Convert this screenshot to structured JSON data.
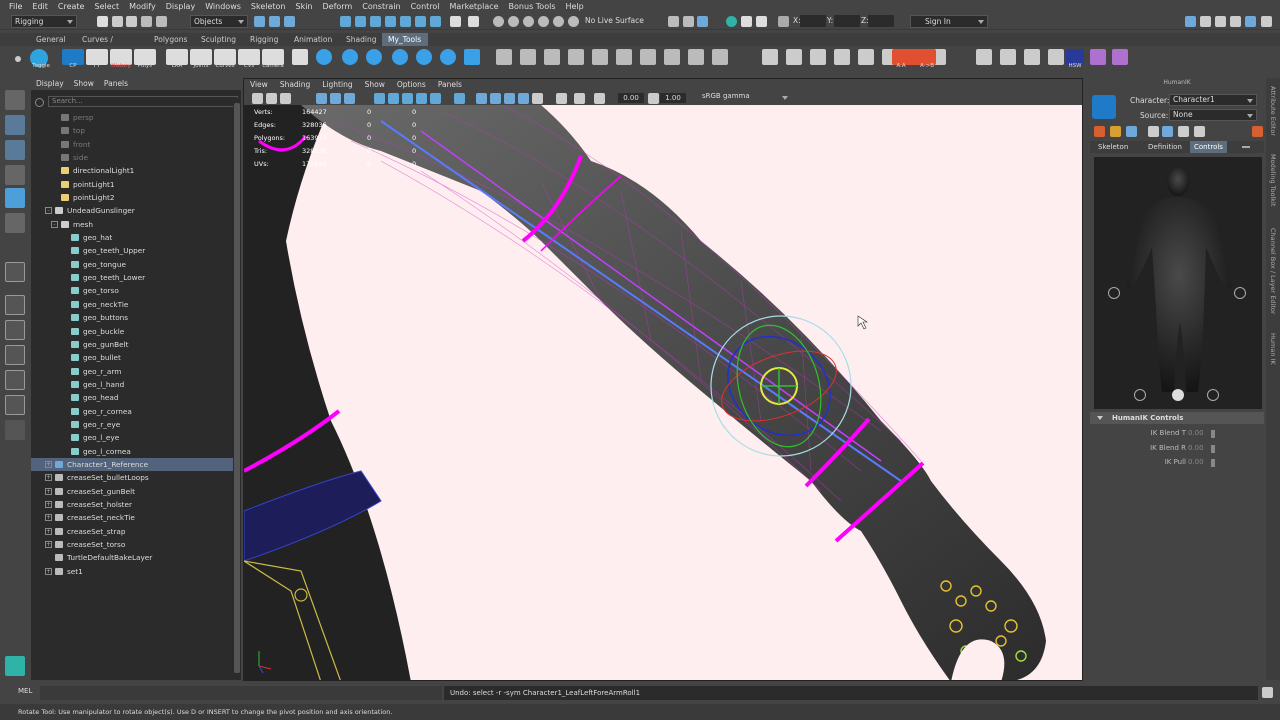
{
  "menu": [
    "File",
    "Edit",
    "Create",
    "Select",
    "Modify",
    "Display",
    "Windows",
    "Skeleton",
    "Skin",
    "Deform",
    "Constrain",
    "Control",
    "Marketplace",
    "Bonus Tools",
    "Help"
  ],
  "status": {
    "mode": "Rigging",
    "select_mode": "Objects",
    "live_surface": "No Live Surface",
    "x_label": "X:",
    "y_label": "Y:",
    "z_label": "Z:",
    "sign_in": "Sign In"
  },
  "shelf_tabs": [
    "General",
    "Curves / Surfaces",
    "Polygons",
    "Sculpting",
    "Rigging",
    "Animation",
    "Shading",
    "My_Tools"
  ],
  "shelf_active": "My_Tools",
  "shelf_labels": [
    "Toggle",
    "CP",
    "FT",
    "History",
    "Polys",
    "LRA",
    "Joints",
    "Curves",
    "CVs",
    "Camera"
  ],
  "shelf_right_labels": [
    "A:A",
    "A->B",
    "HSW"
  ],
  "outliner": {
    "menu": [
      "Display",
      "Show",
      "Panels"
    ],
    "search_placeholder": "Search...",
    "items": [
      {
        "label": "persp",
        "level": 1,
        "dim": true,
        "icon": "camera-icon"
      },
      {
        "label": "top",
        "level": 1,
        "dim": true,
        "icon": "camera-icon"
      },
      {
        "label": "front",
        "level": 1,
        "dim": true,
        "icon": "camera-icon"
      },
      {
        "label": "side",
        "level": 1,
        "dim": true,
        "icon": "camera-icon"
      },
      {
        "label": "directionalLight1",
        "level": 1,
        "icon": "light-icon"
      },
      {
        "label": "pointLight1",
        "level": 1,
        "icon": "light-icon"
      },
      {
        "label": "pointLight2",
        "level": 1,
        "icon": "light-icon"
      },
      {
        "label": "UndeadGunslinger",
        "level": 0,
        "expand": "-",
        "icon": "group-icon"
      },
      {
        "label": "mesh",
        "level": 1,
        "expand": "-",
        "icon": "group-icon"
      },
      {
        "label": "geo_hat",
        "level": 2,
        "icon": "mesh-icon"
      },
      {
        "label": "geo_teeth_Upper",
        "level": 2,
        "icon": "mesh-icon"
      },
      {
        "label": "geo_tongue",
        "level": 2,
        "icon": "mesh-icon"
      },
      {
        "label": "geo_teeth_Lower",
        "level": 2,
        "icon": "mesh-icon"
      },
      {
        "label": "geo_torso",
        "level": 2,
        "icon": "mesh-icon"
      },
      {
        "label": "geo_neckTie",
        "level": 2,
        "icon": "mesh-icon"
      },
      {
        "label": "geo_buttons",
        "level": 2,
        "icon": "mesh-icon"
      },
      {
        "label": "geo_buckle",
        "level": 2,
        "icon": "mesh-icon"
      },
      {
        "label": "geo_gunBelt",
        "level": 2,
        "icon": "mesh-icon"
      },
      {
        "label": "geo_bullet",
        "level": 2,
        "icon": "mesh-icon"
      },
      {
        "label": "geo_r_arm",
        "level": 2,
        "icon": "mesh-icon"
      },
      {
        "label": "geo_l_hand",
        "level": 2,
        "icon": "mesh-icon"
      },
      {
        "label": "geo_head",
        "level": 2,
        "icon": "mesh-icon"
      },
      {
        "label": "geo_r_cornea",
        "level": 2,
        "icon": "mesh-icon"
      },
      {
        "label": "geo_r_eye",
        "level": 2,
        "icon": "mesh-icon"
      },
      {
        "label": "geo_l_eye",
        "level": 2,
        "icon": "mesh-icon"
      },
      {
        "label": "geo_l_cornea",
        "level": 2,
        "icon": "mesh-icon"
      },
      {
        "label": "Character1_Reference",
        "level": 0,
        "expand": "+",
        "icon": "joint-icon",
        "selected": true
      },
      {
        "label": "creaseSet_bulletLoops",
        "level": 0,
        "expand": "+",
        "icon": "set-icon"
      },
      {
        "label": "creaseSet_gunBelt",
        "level": 0,
        "expand": "+",
        "icon": "set-icon"
      },
      {
        "label": "creaseSet_holster",
        "level": 0,
        "expand": "+",
        "icon": "set-icon"
      },
      {
        "label": "creaseSet_neckTie",
        "level": 0,
        "expand": "+",
        "icon": "set-icon"
      },
      {
        "label": "creaseSet_strap",
        "level": 0,
        "expand": "+",
        "icon": "set-icon"
      },
      {
        "label": "creaseSet_torso",
        "level": 0,
        "expand": "+",
        "icon": "set-icon"
      },
      {
        "label": "TurtleDefaultBakeLayer",
        "level": 0,
        "icon": "set-icon"
      },
      {
        "label": "set1",
        "level": 0,
        "expand": "+",
        "icon": "set-icon"
      }
    ]
  },
  "viewport": {
    "menu": [
      "View",
      "Shading",
      "Lighting",
      "Show",
      "Options",
      "Panels"
    ],
    "value_a": "0.00",
    "value_b": "1.00",
    "colorspace": "sRGB gamma",
    "hud": [
      {
        "k": "Verts:",
        "v1": "164427",
        "v2": "0",
        "v3": "0"
      },
      {
        "k": "Edges:",
        "v1": "328036",
        "v2": "0",
        "v3": "0"
      },
      {
        "k": "Polygons:",
        "v1": "163933",
        "v2": "0",
        "v3": "0"
      },
      {
        "k": "Tris:",
        "v1": "328236",
        "v2": "0",
        "v3": "0"
      },
      {
        "k": "UVs:",
        "v1": "175890",
        "v2": "0",
        "v3": "0"
      }
    ]
  },
  "humanik": {
    "title": "HumanIK",
    "character_label": "Character:",
    "character_value": "Character1",
    "source_label": "Source:",
    "source_value": "None",
    "tabs": [
      "Skeleton",
      "Definition",
      "Controls"
    ],
    "active_tab": "Controls",
    "controls_header": "HumanIK Controls",
    "params": [
      {
        "label": "IK Blend T",
        "value": "0.00"
      },
      {
        "label": "IK Blend R",
        "value": "0.00"
      },
      {
        "label": "IK Pull",
        "value": "0.00"
      }
    ]
  },
  "sidebar_tabs": [
    "Attribute Editor",
    "Modeling Toolkit",
    "Channel Box / Layer Editor",
    "Human IK"
  ],
  "cmdline": {
    "lang": "MEL",
    "result": "Undo: select -r -sym Character1_LeafLeftForeArmRoll1"
  },
  "helpline": "Rotate Tool: Use manipulator to rotate object(s). Use D or INSERT to change the pivot position and axis orientation.",
  "colors": {
    "accent": "#5d6d7e",
    "selection": "#52637b",
    "viewport_bg": "#ffeeef",
    "wire": "#ff00ff"
  }
}
